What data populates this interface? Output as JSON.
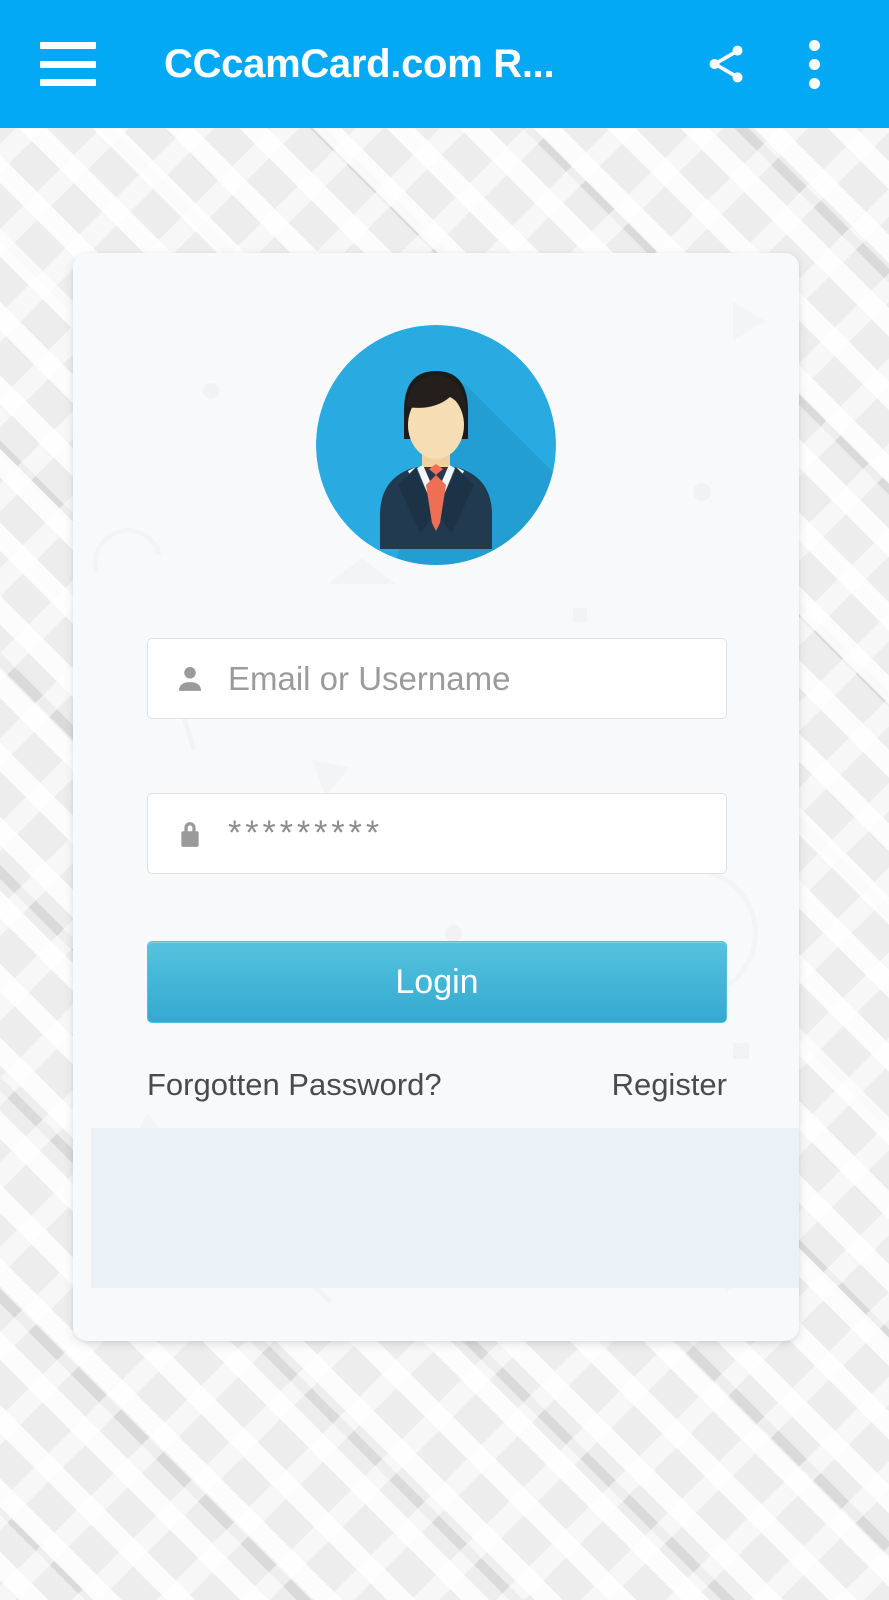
{
  "toolbar": {
    "menu_icon": "hamburger-menu-icon",
    "title": "CCcamCard.com R...",
    "share_icon": "share-icon",
    "overflow_icon": "more-vertical-icon",
    "background_color": "#03a9f4",
    "text_color": "#ffffff"
  },
  "card": {
    "avatar_icon": "user-avatar-businessman-icon",
    "avatar_circle_color": "#29ABE2",
    "background_color": "#f8f9fb",
    "form": {
      "username": {
        "icon": "person-icon",
        "value": "",
        "placeholder": "Email or Username"
      },
      "password": {
        "icon": "lock-icon",
        "value": "*********",
        "placeholder": "*********"
      },
      "login_button": {
        "label": "Login",
        "color_top": "#56c2de",
        "color_bottom": "#34a9d0"
      },
      "forgot_link": "Forgotten Password?",
      "register_link": "Register"
    },
    "ad_banner": {
      "label": "",
      "background_color": "#eaf2f8"
    }
  },
  "page": {
    "background_color": "#ededed"
  }
}
